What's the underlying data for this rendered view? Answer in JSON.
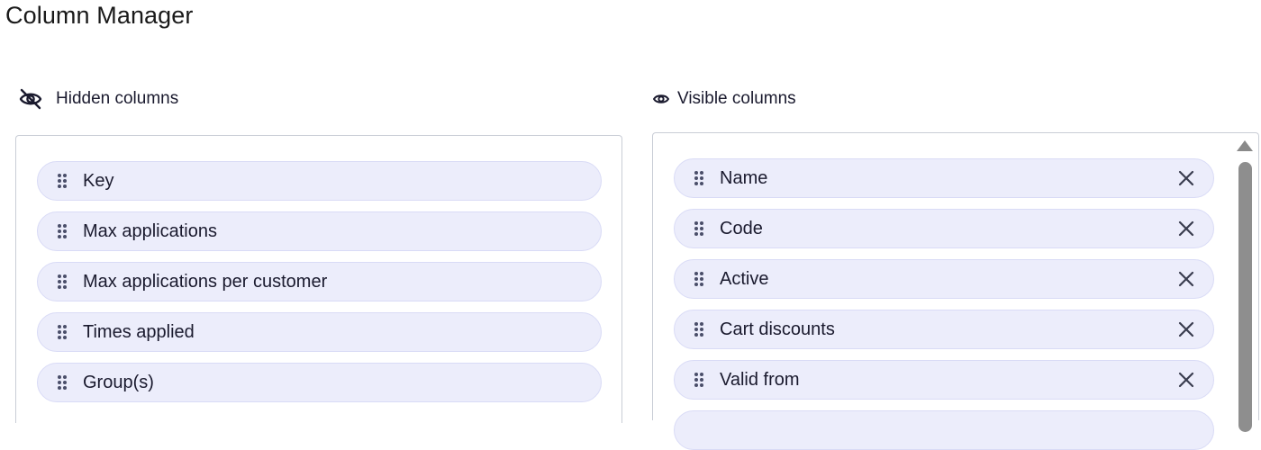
{
  "page": {
    "title": "Column Manager"
  },
  "hidden": {
    "header": "Hidden columns",
    "icon": "eye-off-icon",
    "items": [
      {
        "label": "Key"
      },
      {
        "label": "Max applications"
      },
      {
        "label": "Max applications per customer"
      },
      {
        "label": "Times applied"
      },
      {
        "label": "Group(s)"
      }
    ]
  },
  "visible": {
    "header": "Visible columns",
    "icon": "eye-icon",
    "items": [
      {
        "label": "Name"
      },
      {
        "label": "Code"
      },
      {
        "label": "Active"
      },
      {
        "label": "Cart discounts"
      },
      {
        "label": "Valid from"
      },
      {
        "label": ""
      }
    ]
  },
  "colors": {
    "item_bg": "#ecedfb",
    "item_border": "#d9dbf6",
    "panel_border": "#c9cdd6",
    "scrollbar": "#8e8e8e"
  }
}
